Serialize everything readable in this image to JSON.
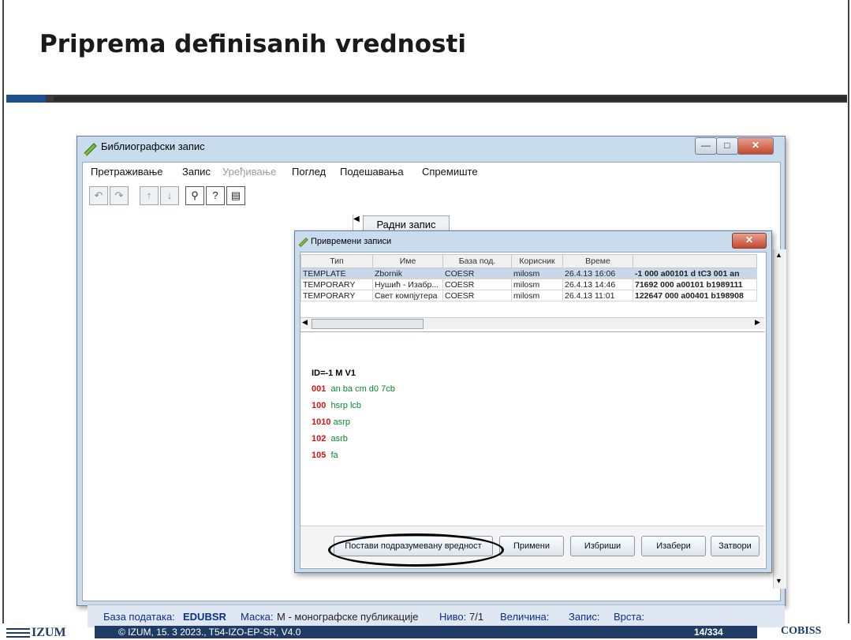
{
  "slide": {
    "title": "Priprema definisanih vrednosti"
  },
  "window": {
    "title": "Библиографски запис",
    "menu": [
      "Претраживање",
      "Запис",
      "Уређивање",
      "Поглед",
      "Подешавања",
      "Спремиште"
    ],
    "menu_disabled": [
      false,
      false,
      true,
      false,
      false,
      false
    ],
    "tab_label": "Радни запис",
    "minimize": "—",
    "maximize": "□",
    "close": "✕"
  },
  "dialog": {
    "title": "Привремени записи",
    "close": "✕",
    "columns": [
      "Тип",
      "Име",
      "База под.",
      "Корисник",
      "Време",
      ""
    ],
    "rows": [
      {
        "type": "TEMPLATE",
        "name": "Zbornik",
        "db": "COESR",
        "user": "milosm",
        "time": "26.4.13 16:06",
        "preview": "-1 000 a00101 d tC3 001 an",
        "selected": true
      },
      {
        "type": "TEMPORARY",
        "name": "Нушић - Изабр...",
        "db": "COESR",
        "user": "milosm",
        "time": "26.4.13 14:46",
        "preview": "71692 000 a00101 b1989111",
        "selected": false
      },
      {
        "type": "TEMPORARY",
        "name": "Свет компјутера",
        "db": "COESR",
        "user": "milosm",
        "time": "26.4.13 11:01",
        "preview": "122647 000 a00401 b198908",
        "selected": false
      }
    ],
    "preview_header": "ID=-1 M V1",
    "preview_lines": [
      {
        "tag": "001",
        "text": "an ba cm d0 7cb"
      },
      {
        "tag": "100",
        "text": "hsrp lcb"
      },
      {
        "tag": "1010",
        "text": "asrp"
      },
      {
        "tag": "102",
        "text": "asrb"
      },
      {
        "tag": "105",
        "text": "fa"
      }
    ],
    "buttons": [
      "Постави подразумевану вредност",
      "Примени",
      "Избриши",
      "Изабери",
      "Затвори"
    ]
  },
  "status": {
    "db_label": "База података:",
    "db_value": "EDUBSR",
    "mask_label": "Маска:",
    "mask_value": "M - монографске публикације",
    "level_label": "Ниво:",
    "level_value": "7/1",
    "size_label": "Величина:",
    "record_label": "Запис:",
    "type_label": "Врста:"
  },
  "footer": {
    "org": "IZUM",
    "text": "© IZUM, 15. 3 2023., T54-IZO-EP-SR, V4.0",
    "page": "14/334",
    "logo": "COBISS"
  },
  "colors": {
    "title_bar": "#c9dced",
    "status_text": "#0b2f8a",
    "tag_red": "#d11111",
    "subfield_green": "#0a8a2a",
    "footer_blue": "#1e3c66"
  }
}
